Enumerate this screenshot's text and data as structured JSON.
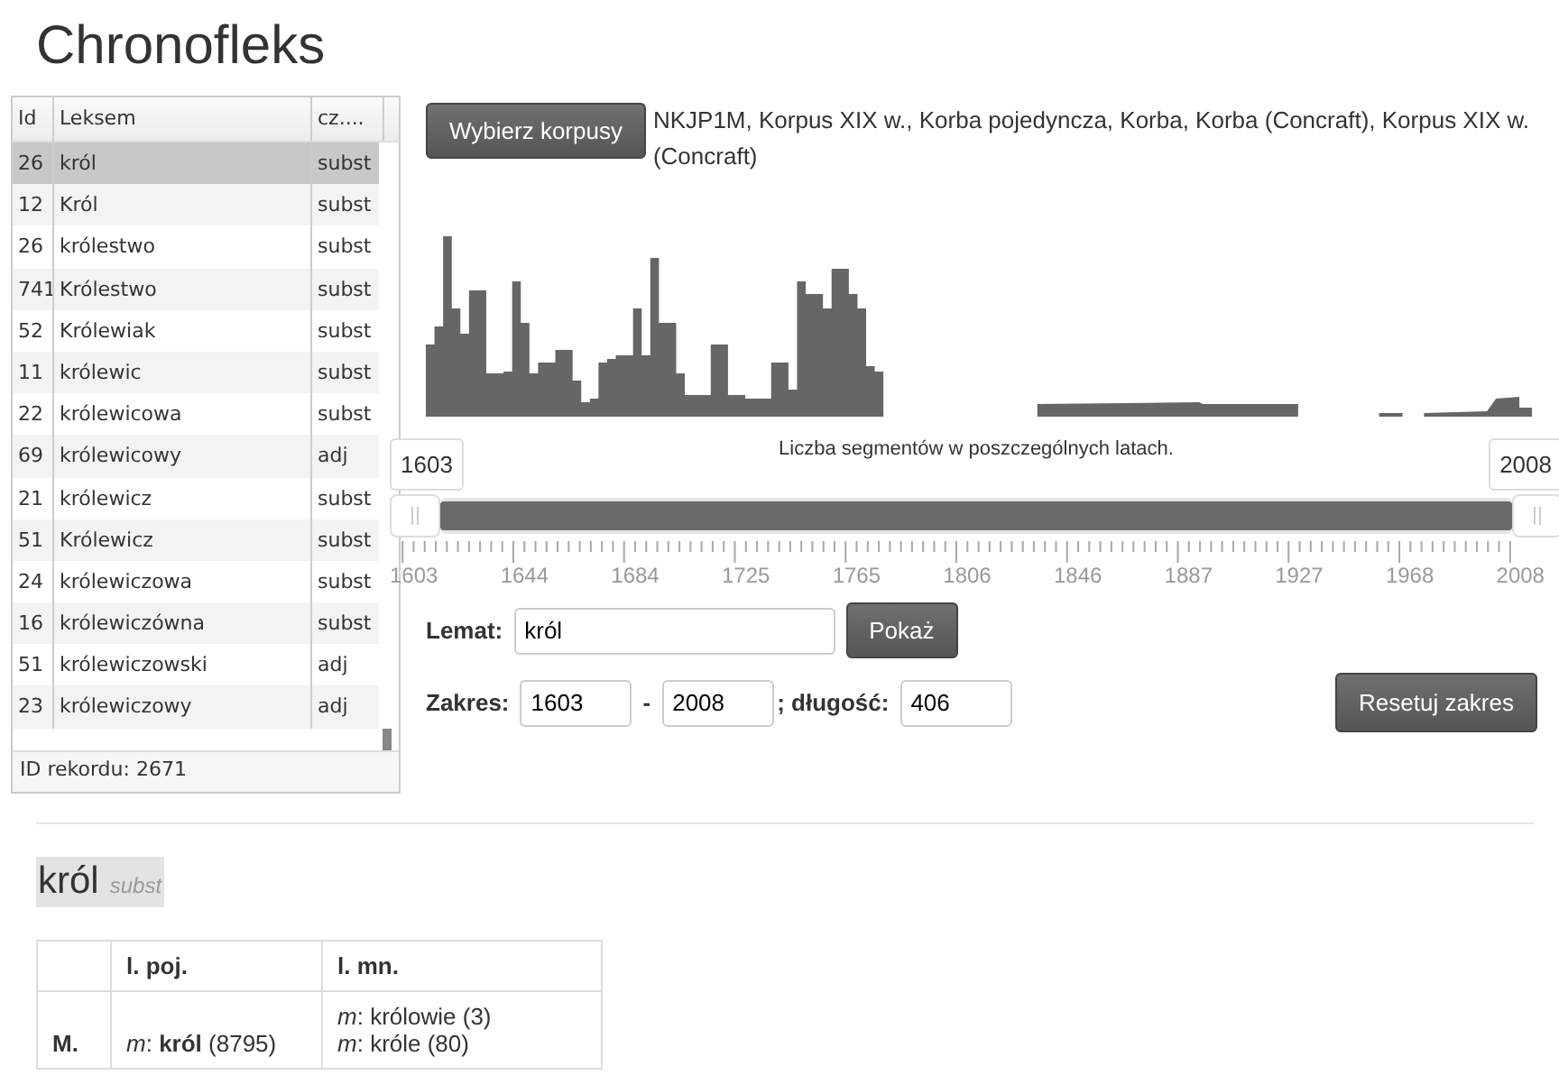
{
  "title": "Chronofleks",
  "lexeme_table": {
    "columns": [
      "Id",
      "Leksem",
      "cz...."
    ],
    "rows": [
      {
        "id": "26",
        "lexeme": "król",
        "pos": "subst",
        "selected": true
      },
      {
        "id": "12",
        "lexeme": "Król",
        "pos": "subst",
        "selected": false
      },
      {
        "id": "26",
        "lexeme": "królestwo",
        "pos": "subst",
        "selected": false
      },
      {
        "id": "741",
        "lexeme": "Królestwo",
        "pos": "subst",
        "selected": false
      },
      {
        "id": "52",
        "lexeme": "Królewiak",
        "pos": "subst",
        "selected": false
      },
      {
        "id": "11",
        "lexeme": "królewic",
        "pos": "subst",
        "selected": false
      },
      {
        "id": "22",
        "lexeme": "królewicowa",
        "pos": "subst",
        "selected": false
      },
      {
        "id": "69",
        "lexeme": "królewicowy",
        "pos": "adj",
        "selected": false
      },
      {
        "id": "21",
        "lexeme": "królewicz",
        "pos": "subst",
        "selected": false
      },
      {
        "id": "51",
        "lexeme": "Królewicz",
        "pos": "subst",
        "selected": false
      },
      {
        "id": "24",
        "lexeme": "królewiczowa",
        "pos": "subst",
        "selected": false
      },
      {
        "id": "16",
        "lexeme": "królewiczówna",
        "pos": "subst",
        "selected": false
      },
      {
        "id": "51",
        "lexeme": "królewiczowski",
        "pos": "adj",
        "selected": false
      },
      {
        "id": "23",
        "lexeme": "królewiczowy",
        "pos": "adj",
        "selected": false
      }
    ],
    "record_id": "ID rekordu: 2671"
  },
  "corpora": {
    "button": "Wybierz korpusy",
    "list": "NKJP1M, Korpus XIX w., Korba pojedyncza, Korba, Korba (Concraft), Korpus XIX w. (Concraft)"
  },
  "histogram_caption": "Liczba segmentów w poszczególnych latach.",
  "slider": {
    "handles": [
      {
        "label": "1603"
      },
      {
        "label": "2008"
      }
    ],
    "level": 1,
    "tick_labels": [
      "1603",
      "1644",
      "1684",
      "1725",
      "1765",
      "1806",
      "1846",
      "1887",
      "1927",
      "1968",
      "2008"
    ]
  },
  "lemma": {
    "label": "Lemat:",
    "value": "król",
    "button": "Pokaż"
  },
  "range": {
    "label": "Zakres:",
    "from": "1603",
    "separator": "-",
    "to": "2008",
    "length_label": "; długość:",
    "length": "406",
    "reset_button": "Resetuj zakres"
  },
  "entry": {
    "lemma": "król",
    "pos": "subst"
  },
  "inflection_table": {
    "columns": [
      "",
      "l. poj.",
      "l. mn."
    ],
    "rows": [
      {
        "case": "M.",
        "singular": [
          "*m*: **król** (8795)"
        ],
        "plural": [
          "*m*: królowie (3)",
          "*m*: króle (80)"
        ]
      }
    ]
  }
}
